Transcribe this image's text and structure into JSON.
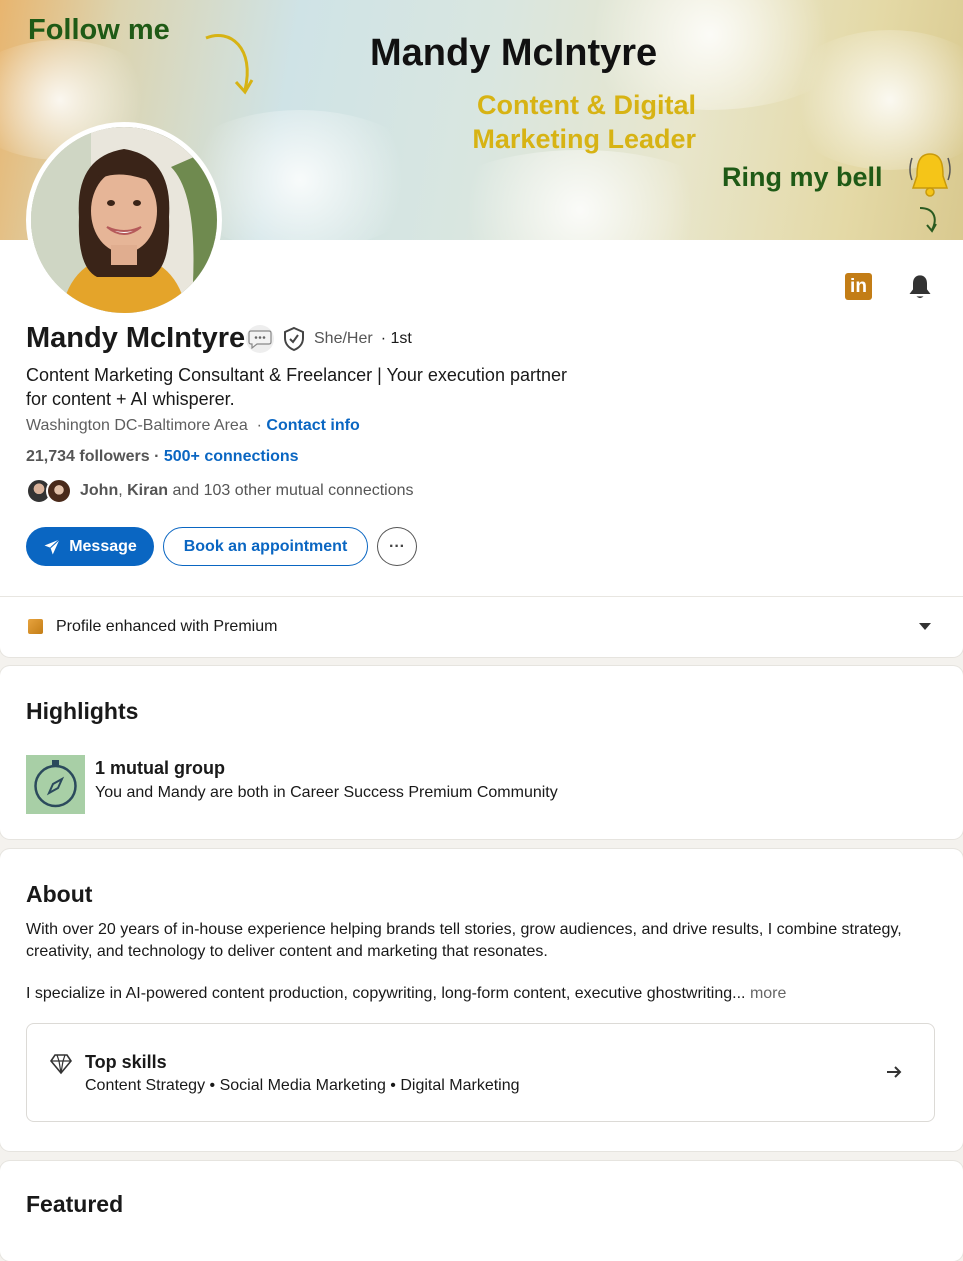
{
  "banner": {
    "follow_text": "Follow me",
    "name": "Mandy McIntyre",
    "tagline_line1": "Content & Digital",
    "tagline_line2": "Marketing Leader",
    "ring_text": "Ring my bell"
  },
  "profile": {
    "name": "Mandy McIntyre",
    "pronouns": "She/Her",
    "degree": "· 1st",
    "headline": "Content Marketing Consultant & Freelancer | Your execution partner for content + AI whisperer.",
    "location": "Washington DC-Baltimore Area",
    "location_sep": "·",
    "contact_info": "Contact info",
    "followers": "21,734 followers",
    "stats_sep": "·",
    "connections": "500+ connections",
    "mutual_name1": "John",
    "mutual_sep": ", ",
    "mutual_name2": "Kiran",
    "mutual_rest": " and 103 other mutual connections"
  },
  "actions": {
    "message": "Message",
    "book": "Book an appointment",
    "more": "···"
  },
  "premium": {
    "label": "Profile enhanced with Premium"
  },
  "highlights": {
    "title": "Highlights",
    "group_title": "1 mutual group",
    "group_desc": "You and Mandy are both in Career Success Premium Community"
  },
  "about": {
    "title": "About",
    "para1": "With over 20 years of in-house experience helping brands tell stories, grow audiences, and drive results, I combine strategy, creativity, and technology to deliver content and marketing that resonates.",
    "para2": "I specialize in AI-powered content production, copywriting, long-form content, executive ghostwriting...",
    "more": "more",
    "skills_title": "Top skills",
    "skills_list": "Content Strategy • Social Media Marketing • Digital Marketing"
  },
  "featured": {
    "title": "Featured"
  },
  "icons": {
    "linkedin": "linkedin-icon",
    "bell": "bell-icon",
    "message": "paper-plane-icon",
    "diamond": "diamond-icon",
    "arrow": "arrow-right-icon",
    "compass": "compass-icon",
    "verified": "shield-check-icon",
    "speech": "speech-bubble-icon"
  },
  "colors": {
    "brand_blue": "#0a66c2",
    "premium_gold": "#c37d16",
    "banner_green": "#1f5a16",
    "banner_yellow": "#d7b314"
  }
}
